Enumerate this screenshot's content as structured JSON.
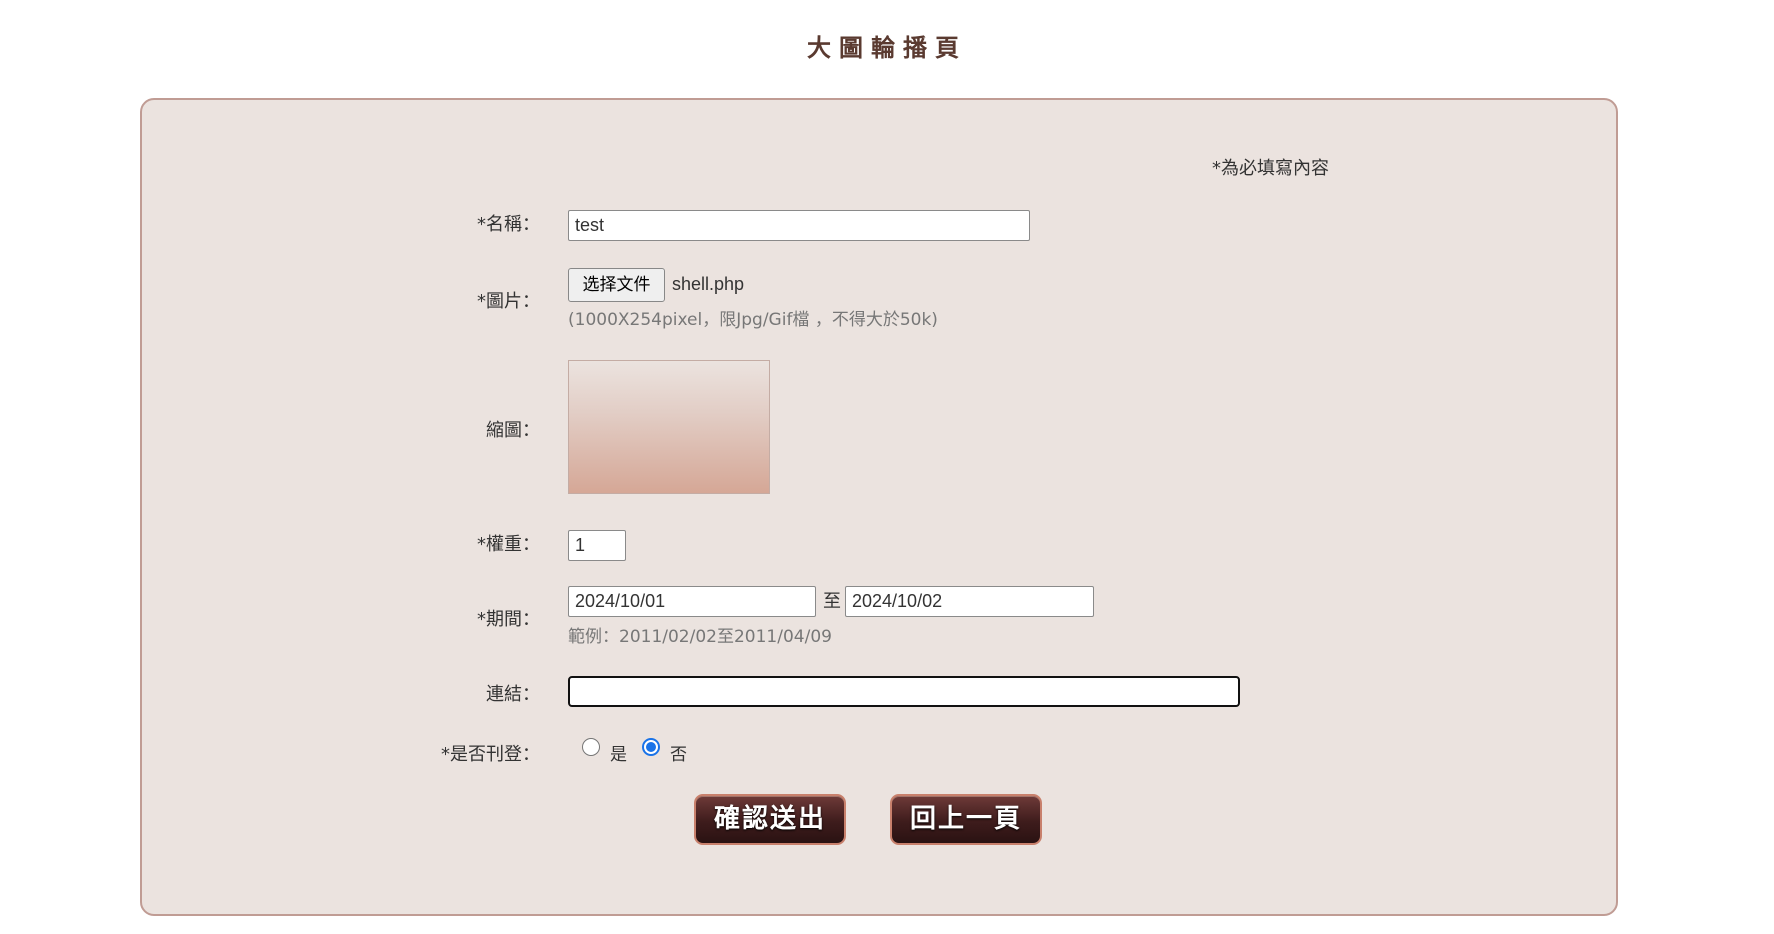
{
  "page": {
    "title": "大圖輪播頁"
  },
  "form": {
    "required_note": "*為必填寫內容",
    "name": {
      "label": "*名稱：",
      "value": "test"
    },
    "image": {
      "label": "*圖片：",
      "button_label": "选择文件",
      "file_name": "shell.php",
      "hint": "(1000X254pixel，限Jpg/Gif檔 ，不得大於50k)"
    },
    "thumbnail": {
      "label": "縮圖："
    },
    "weight": {
      "label": "*權重：",
      "value": "1"
    },
    "period": {
      "label": "*期間：",
      "start": "2024/10/01",
      "separator": "至",
      "end": "2024/10/02",
      "hint": "範例：2011/02/02至2011/04/09"
    },
    "link": {
      "label": "連結：",
      "value": ""
    },
    "publish": {
      "label": "*是否刊登：",
      "yes_label": "是",
      "no_label": "否",
      "selected": "否"
    }
  },
  "actions": {
    "submit_label": "確認送出",
    "back_label": "回上一頁"
  },
  "colors": {
    "panel_background": "#ebe3df",
    "panel_border": "#c09c94",
    "title_color": "#5a3a30",
    "radio_accent": "#1a73e8",
    "button_background": "#3e1c1c"
  }
}
